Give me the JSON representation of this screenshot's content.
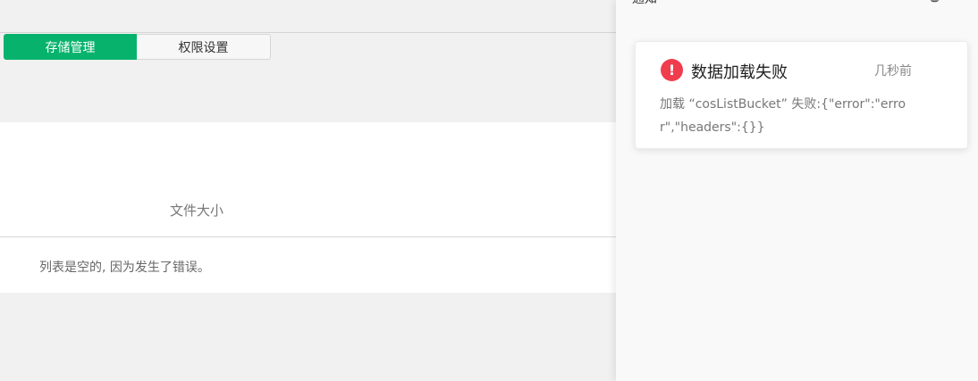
{
  "tabs": [
    {
      "label": "存储管理",
      "active": true
    },
    {
      "label": "权限设置",
      "active": false
    }
  ],
  "table": {
    "column_header": "文件大小",
    "empty_message": "列表是空的, 因为发生了错误。"
  },
  "drawer": {
    "title": "通知"
  },
  "notification": {
    "icon": "exclamation-icon",
    "icon_glyph": "!",
    "title": "数据加载失败",
    "time": "几秒前",
    "body": "加载 “cosListBucket” 失败:{\"error\":\"error\",\"headers\":{}}"
  },
  "colors": {
    "accent": "#07b36c",
    "error": "#f03c4c"
  }
}
